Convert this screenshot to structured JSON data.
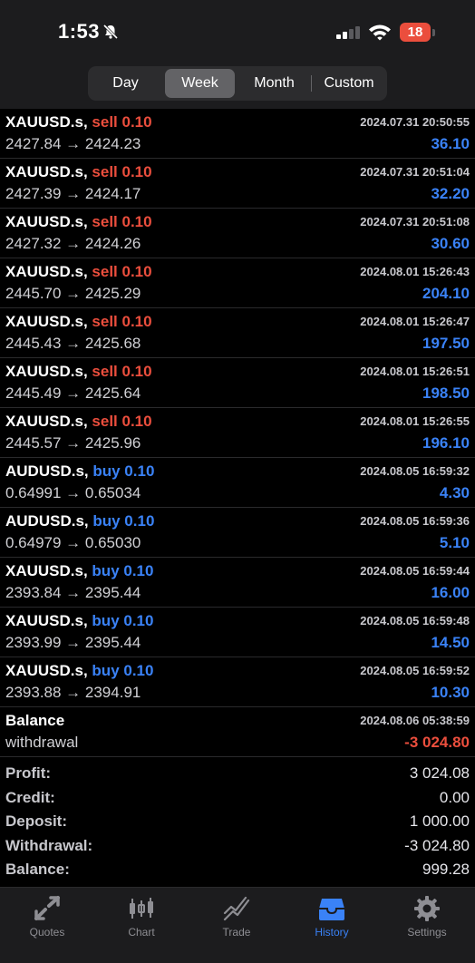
{
  "status": {
    "time": "1:53",
    "battery": "18"
  },
  "periods": [
    {
      "label": "Day"
    },
    {
      "label": "Week"
    },
    {
      "label": "Month"
    },
    {
      "label": "Custom"
    }
  ],
  "deals": [
    {
      "symbol": "XAUUSD.s,",
      "side": "sell 0.10",
      "sidetype": "sell",
      "time": "2024.07.31 20:50:55",
      "prices": "2427.84 → 2424.23",
      "profit": "36.10"
    },
    {
      "symbol": "XAUUSD.s,",
      "side": "sell 0.10",
      "sidetype": "sell",
      "time": "2024.07.31 20:51:04",
      "prices": "2427.39 → 2424.17",
      "profit": "32.20"
    },
    {
      "symbol": "XAUUSD.s,",
      "side": "sell 0.10",
      "sidetype": "sell",
      "time": "2024.07.31 20:51:08",
      "prices": "2427.32 → 2424.26",
      "profit": "30.60"
    },
    {
      "symbol": "XAUUSD.s,",
      "side": "sell 0.10",
      "sidetype": "sell",
      "time": "2024.08.01 15:26:43",
      "prices": "2445.70 → 2425.29",
      "profit": "204.10"
    },
    {
      "symbol": "XAUUSD.s,",
      "side": "sell 0.10",
      "sidetype": "sell",
      "time": "2024.08.01 15:26:47",
      "prices": "2445.43 → 2425.68",
      "profit": "197.50"
    },
    {
      "symbol": "XAUUSD.s,",
      "side": "sell 0.10",
      "sidetype": "sell",
      "time": "2024.08.01 15:26:51",
      "prices": "2445.49 → 2425.64",
      "profit": "198.50"
    },
    {
      "symbol": "XAUUSD.s,",
      "side": "sell 0.10",
      "sidetype": "sell",
      "time": "2024.08.01 15:26:55",
      "prices": "2445.57 → 2425.96",
      "profit": "196.10"
    },
    {
      "symbol": "AUDUSD.s,",
      "side": "buy 0.10",
      "sidetype": "buy",
      "time": "2024.08.05 16:59:32",
      "prices": "0.64991 → 0.65034",
      "profit": "4.30"
    },
    {
      "symbol": "AUDUSD.s,",
      "side": "buy 0.10",
      "sidetype": "buy",
      "time": "2024.08.05 16:59:36",
      "prices": "0.64979 → 0.65030",
      "profit": "5.10"
    },
    {
      "symbol": "XAUUSD.s,",
      "side": "buy 0.10",
      "sidetype": "buy",
      "time": "2024.08.05 16:59:44",
      "prices": "2393.84 → 2395.44",
      "profit": "16.00"
    },
    {
      "symbol": "XAUUSD.s,",
      "side": "buy 0.10",
      "sidetype": "buy",
      "time": "2024.08.05 16:59:48",
      "prices": "2393.99 → 2395.44",
      "profit": "14.50"
    },
    {
      "symbol": "XAUUSD.s,",
      "side": "buy 0.10",
      "sidetype": "buy",
      "time": "2024.08.05 16:59:52",
      "prices": "2393.88 → 2394.91",
      "profit": "10.30"
    }
  ],
  "balance_op": {
    "title": "Balance",
    "time": "2024.08.06 05:38:59",
    "comment": "withdrawal",
    "amount": "-3 024.80"
  },
  "summary": [
    {
      "label": "Profit:",
      "value": "3 024.08"
    },
    {
      "label": "Credit:",
      "value": "0.00"
    },
    {
      "label": "Deposit:",
      "value": "1 000.00"
    },
    {
      "label": "Withdrawal:",
      "value": "-3 024.80"
    },
    {
      "label": "Balance:",
      "value": "999.28"
    }
  ],
  "tabs": [
    {
      "label": "Quotes",
      "icon": "quotes-icon"
    },
    {
      "label": "Chart",
      "icon": "chart-icon"
    },
    {
      "label": "Trade",
      "icon": "trade-icon"
    },
    {
      "label": "History",
      "icon": "history-icon"
    },
    {
      "label": "Settings",
      "icon": "settings-icon"
    }
  ],
  "colors": {
    "sell": "#eb4e3d",
    "buy": "#3a82f7",
    "active_tab": "#3a82f7",
    "battery": "#eb4e3d"
  }
}
